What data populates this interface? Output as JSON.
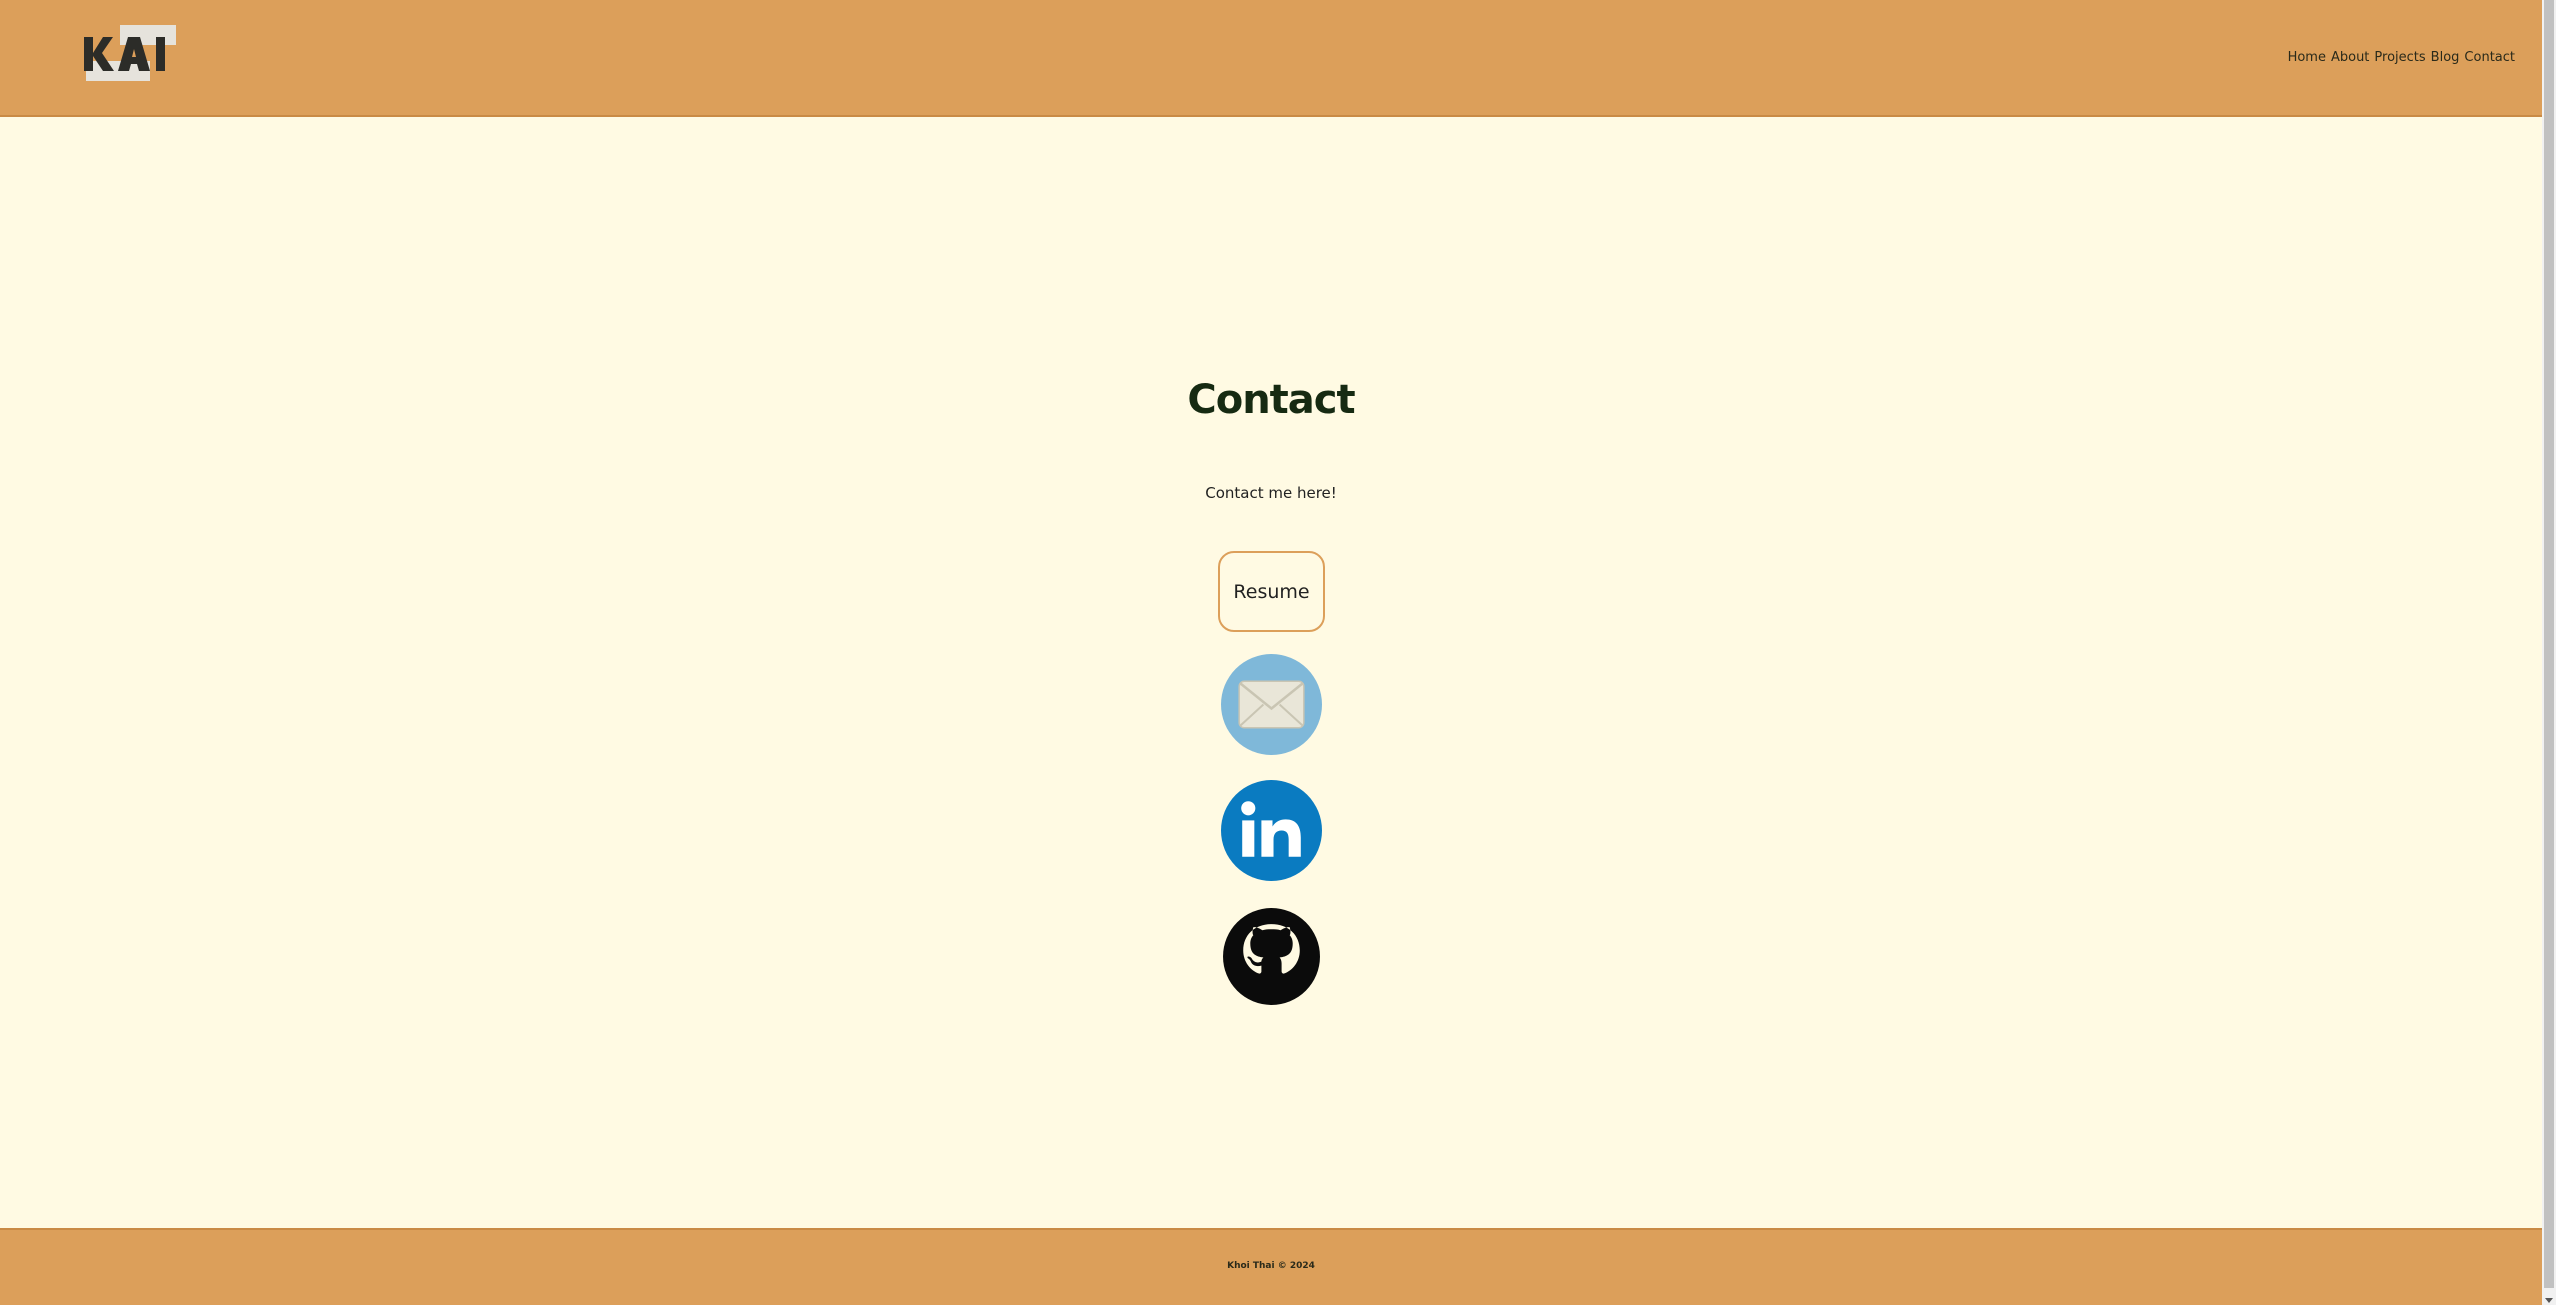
{
  "header": {
    "logo_text": "KAI",
    "nav": [
      {
        "label": "Home"
      },
      {
        "label": "About"
      },
      {
        "label": "Projects"
      },
      {
        "label": "Blog"
      },
      {
        "label": "Contact"
      }
    ]
  },
  "main": {
    "title": "Contact",
    "subtitle": "Contact me here!",
    "resume_label": "Resume",
    "links": [
      {
        "icon": "email-icon"
      },
      {
        "icon": "linkedin-icon"
      },
      {
        "icon": "github-icon"
      }
    ]
  },
  "footer": {
    "text": "Khoi Thai © 2024"
  },
  "colors": {
    "header_bg": "#dc9f5a",
    "page_bg": "#fffae3",
    "title": "#162a12",
    "linkedin": "#0a7bc1",
    "email_bg": "#7fb8d9"
  }
}
